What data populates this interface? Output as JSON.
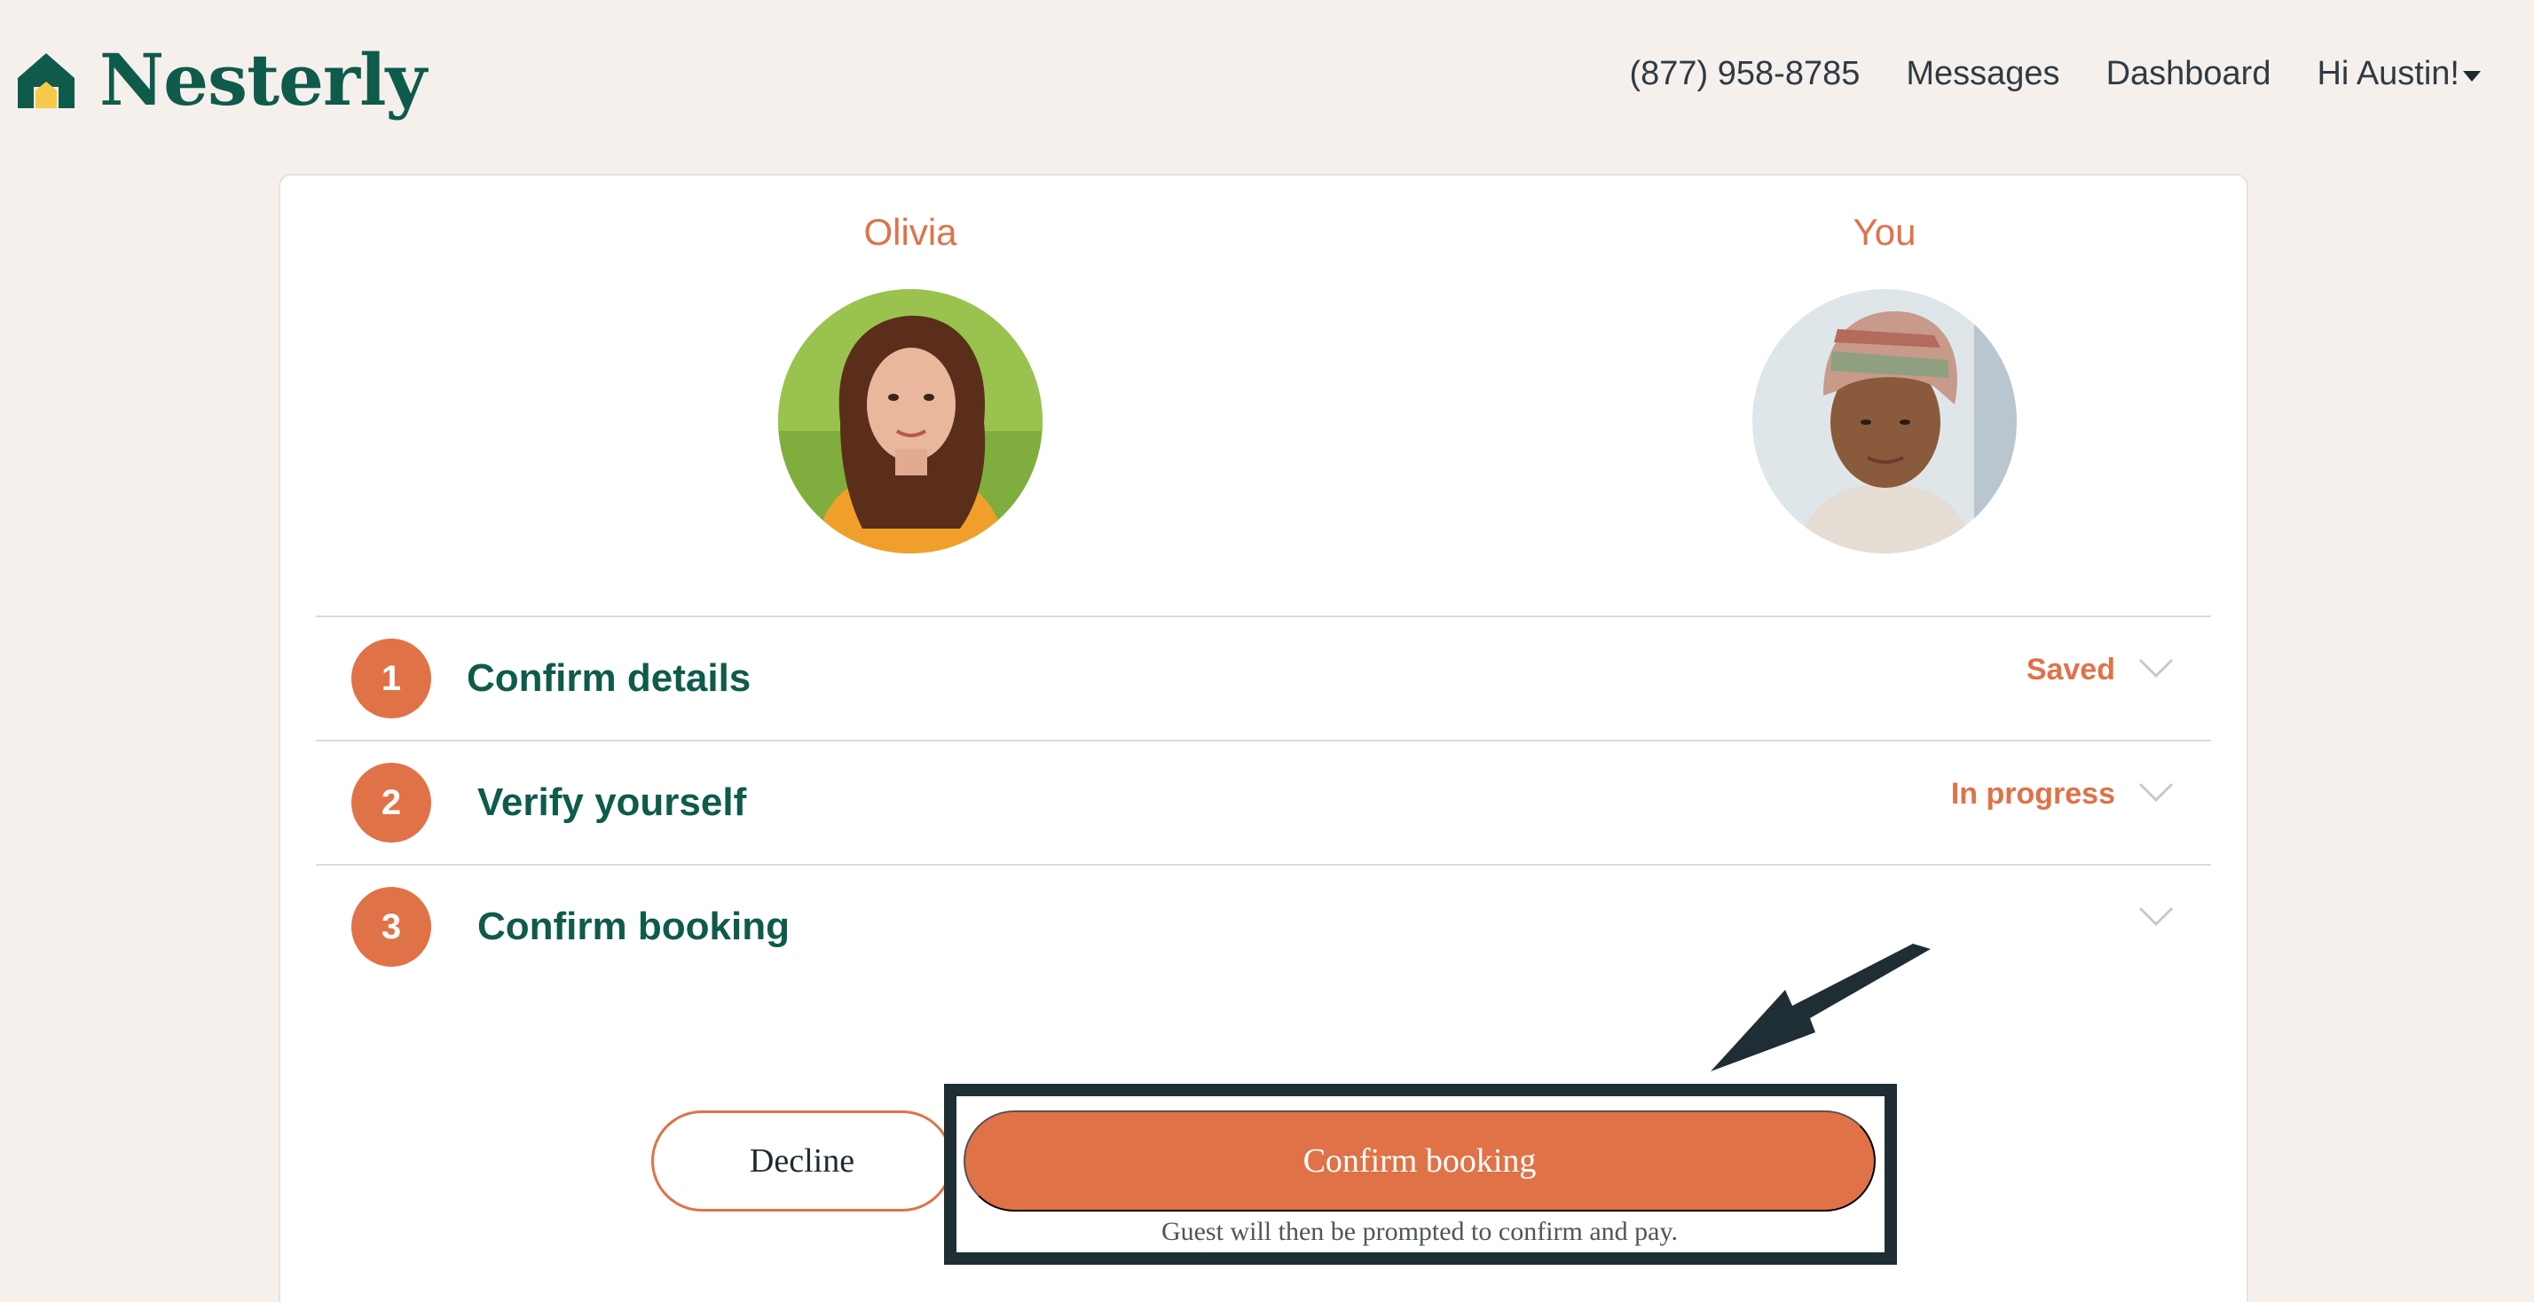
{
  "header": {
    "brand": "Nesterly",
    "phone": "(877) 958-8785",
    "nav_messages": "Messages",
    "nav_dashboard": "Dashboard",
    "greeting": "Hi Austin!",
    "icons": [
      "house-logo-icon",
      "caret-down-icon"
    ]
  },
  "participants": {
    "guest_name": "Olivia",
    "host_name": "You"
  },
  "steps": [
    {
      "number": "1",
      "title": "Confirm details",
      "status": "Saved"
    },
    {
      "number": "2",
      "title": "Verify yourself",
      "status": "In progress"
    },
    {
      "number": "3",
      "title": "Confirm booking",
      "status": ""
    }
  ],
  "actions": {
    "decline_label": "Decline",
    "confirm_label": "Confirm booking",
    "note": "Guest will then be prompted to confirm and pay."
  },
  "colors": {
    "brand_green": "#0e5b4b",
    "accent_orange": "#e07248",
    "highlight_dark": "#1f2e34",
    "page_bg": "#f5f0ec"
  }
}
